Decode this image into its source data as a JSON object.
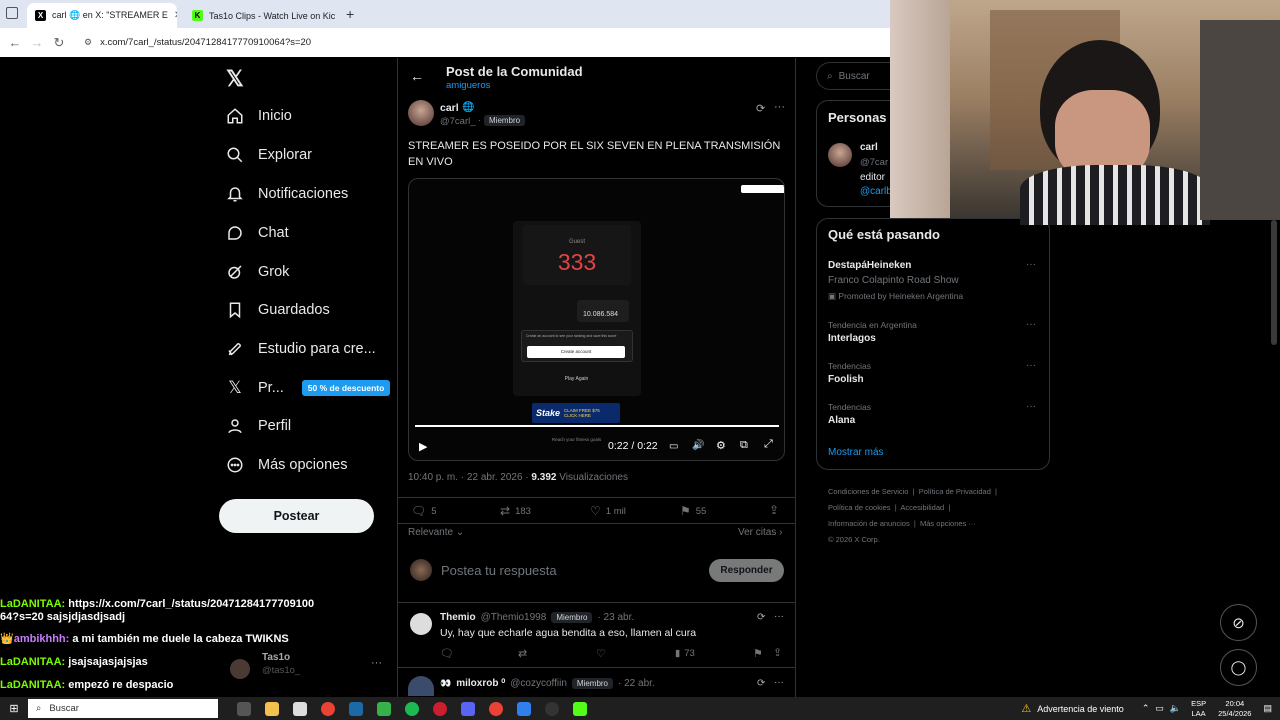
{
  "browser": {
    "tabs": [
      {
        "label": "carl 🌐 en X: \"STREAMER E"
      },
      {
        "label": "Tas1o Clips - Watch Live on Kic"
      }
    ],
    "url": "x.com/7carl_/status/2047128417770910064?s=20"
  },
  "nav": {
    "items": [
      {
        "label": "Inicio",
        "icon": "home-icon"
      },
      {
        "label": "Explorar",
        "icon": "search-icon"
      },
      {
        "label": "Notificaciones",
        "icon": "bell-icon"
      },
      {
        "label": "Chat",
        "icon": "chat-icon"
      },
      {
        "label": "Grok",
        "icon": "grok-icon"
      },
      {
        "label": "Guardados",
        "icon": "bookmark-icon"
      },
      {
        "label": "Estudio para cre...",
        "icon": "rocket-icon"
      },
      {
        "label": "Pr...",
        "icon": "x-icon",
        "badge": "50 % de descuento"
      },
      {
        "label": "Perfil",
        "icon": "person-icon"
      },
      {
        "label": "Más opciones",
        "icon": "more-circle-icon"
      }
    ],
    "post_button": "Postear",
    "account_name": "Tas1o",
    "account_handle": "@tas1o_"
  },
  "post": {
    "header_title": "Post de la Comunidad",
    "community": "amigueros",
    "author": "carl",
    "handle": "@7carl_",
    "member_badge": "Miembro",
    "text": "STREAMER ES POSEIDO POR EL SIX SEVEN EN PLENA TRANSMISIÓN EN VIVO",
    "video": {
      "guest": "Guest",
      "big_number": "333",
      "small_number": "10.086.584",
      "create_prompt": "Create an account to see your ranking and save this score",
      "create_button": "Create account",
      "play_again": "Play Again",
      "stake_label": "Stake",
      "claim_label": "CLAIM FREE $75 CLICK HERE",
      "reach_goals": "Reach your fitness goals",
      "time": "0:22 / 0:22",
      "progress": 1.0
    },
    "time_date": "10:40 p. m. · 22 abr. 2026 ·",
    "views_count": "9.392",
    "views_label": "Visualizaciones",
    "stats": {
      "replies": "5",
      "reposts": "183",
      "likes": "1 mil",
      "bookmarks": "55"
    },
    "sort_label": "Relevante",
    "quotes_label": "Ver citas",
    "reply_placeholder": "Postea tu respuesta",
    "reply_button": "Responder"
  },
  "replies": [
    {
      "name": "Themio",
      "handle": "@Themio1998",
      "badge": "Miembro",
      "date": "· 23 abr.",
      "text": "Uy, hay que echarle agua bendita a eso, llamen al cura",
      "views": "73"
    },
    {
      "name": "miloxrob ⁰",
      "handle": "@cozycoffiin",
      "badge": "Miembro",
      "date": "· 22 abr."
    }
  ],
  "right": {
    "search_placeholder": "Buscar",
    "people_title": "Personas",
    "person_name": "carl",
    "person_handle": "@7car",
    "person_bio": "editor",
    "person_link": "@carlb",
    "trending_title": "Qué está pasando",
    "trends": [
      {
        "context": "",
        "title": "DestapáHeineken",
        "sub": "Franco Colapinto Road Show",
        "promo": "Promoted by Heineken Argentina"
      },
      {
        "context": "Tendencia en Argentina",
        "title": "Interlagos"
      },
      {
        "context": "Tendencias",
        "title": "Foolish"
      },
      {
        "context": "Tendencias",
        "title": "Alana"
      }
    ],
    "show_more": "Mostrar más",
    "footer": [
      "Condiciones de Servicio",
      "Política de Privacidad",
      "Política de cookies",
      "Accesibilidad",
      "Información de anuncios",
      "Más opciones ···",
      "© 2026 X Corp."
    ]
  },
  "chat": [
    {
      "user": "LaDANITAA:",
      "msg": "https://x.com/7carl_/status/20471284177709100",
      "color": "#7cfc00"
    },
    {
      "user": "",
      "msg": "64?s=20 sajsjdjasdjsadj",
      "color": "#ffffff"
    },
    {
      "user": "👑ambikhhh:",
      "msg": "a mi también me duele la cabeza TWIKNS",
      "color": "#c77dff"
    },
    {
      "user": "LaDANITAA:",
      "msg": "jsajsajasjajsjas",
      "color": "#7cfc00"
    },
    {
      "user": "LaDANITAA:",
      "msg": "empezó re despacio",
      "color": "#7cfc00"
    }
  ],
  "taskbar": {
    "search": "Buscar",
    "weather": "Advertencia de viento",
    "lang1": "ESP",
    "lang2": "LAA",
    "time": "20:04",
    "date": "25/4/2026"
  }
}
